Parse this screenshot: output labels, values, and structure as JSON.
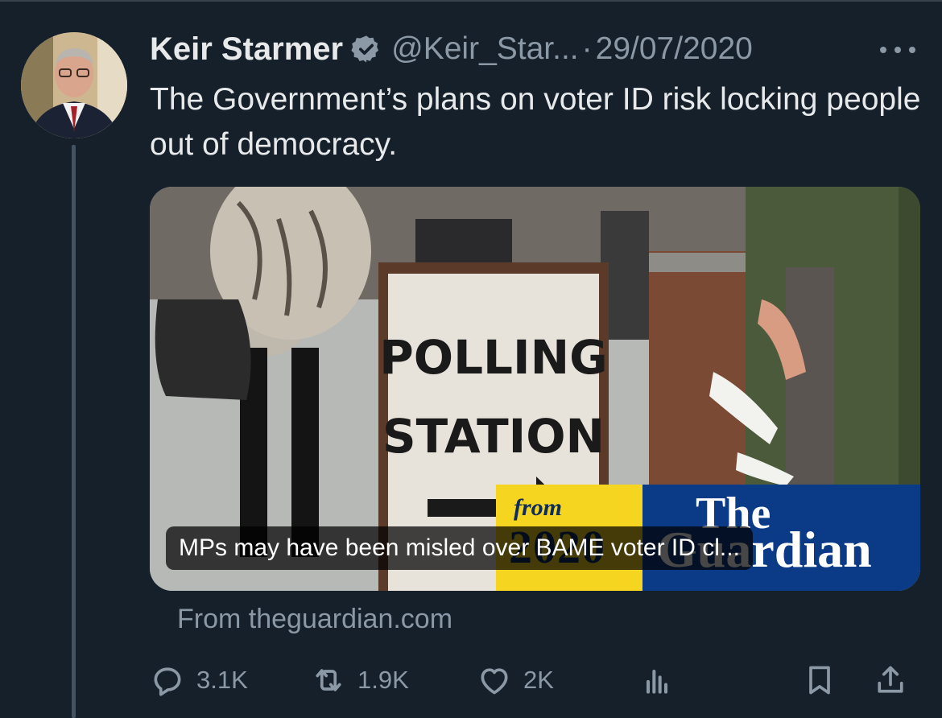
{
  "tweet": {
    "author_name": "Keir Starmer",
    "handle": "@Keir_Star...",
    "separator": "·",
    "date": "29/07/2020",
    "text": "The Government’s plans on voter ID risk locking people out of democracy."
  },
  "card": {
    "sign_line1": "POLLING",
    "sign_line2": "STATION",
    "promo_from": "from",
    "promo_year": "2020",
    "promo_the": "The",
    "promo_guardian": "Guardian",
    "headline": "MPs may have been misled over BAME voter ID cl...",
    "source": "From theguardian.com"
  },
  "actions": {
    "replies": "3.1K",
    "retweets": "1.9K",
    "likes": "2K"
  },
  "icons": [
    "verified-badge-icon",
    "more-icon",
    "reply-icon",
    "retweet-icon",
    "like-icon",
    "views-icon",
    "bookmark-icon",
    "share-icon"
  ],
  "colors": {
    "background": "#15202b",
    "text": "#e7e9ea",
    "muted": "#8b98a5",
    "guardian_blue": "#0b3a87",
    "guardian_yellow": "#f5d51f"
  }
}
